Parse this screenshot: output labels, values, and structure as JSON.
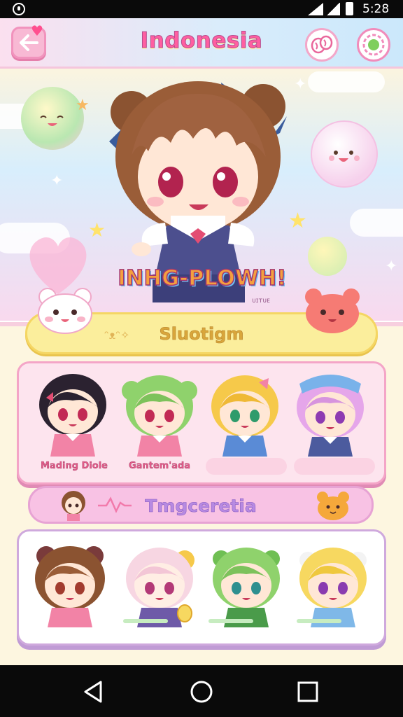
{
  "status_bar": {
    "time": "5:28",
    "icons": [
      "signal-icon",
      "wifi-icon",
      "battery-icon"
    ]
  },
  "header": {
    "title": "Indonesia",
    "back_icon": "back-arrow-icon",
    "shop_icon": "candy-icon",
    "settings_icon": "flower-gear-icon"
  },
  "hero": {
    "title": "INHG-PLOWH!",
    "subtitle": "ᴜɪᴛᴜᴇ"
  },
  "selection_banner": {
    "label": "Sluotigm"
  },
  "panel_one": {
    "characters": [
      {
        "name": "Mading Diole",
        "hair": "#2b2230"
      },
      {
        "name": "Gantem'ada",
        "hair": "#8fd26c"
      },
      {
        "name": "",
        "hair": "#f6c94a"
      },
      {
        "name": "",
        "hair": "#e5a6ea"
      }
    ]
  },
  "category_tab": {
    "label": "Tmgceretia"
  },
  "panel_two": {
    "characters": [
      {
        "hair": "#8b5331"
      },
      {
        "hair": "#f7d6e2"
      },
      {
        "hair": "#8fd26c"
      },
      {
        "hair": "#f7d860"
      }
    ]
  },
  "colors": {
    "accent_pink": "#ff5fa1",
    "banner_yellow": "#fbee9c",
    "panel_pink": "#fde4ee",
    "tab_purple": "#f8c2e4"
  }
}
